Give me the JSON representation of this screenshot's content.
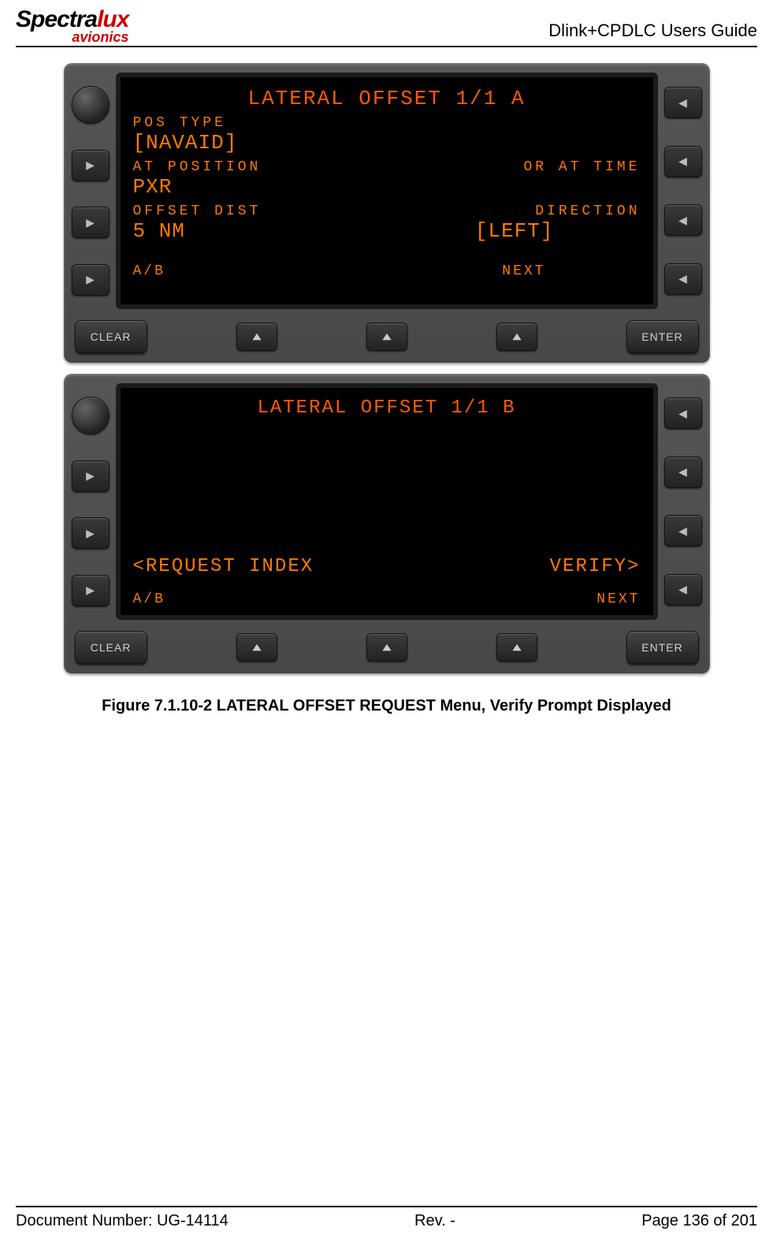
{
  "header": {
    "logo_top_1": "Spectra",
    "logo_top_2": "lux",
    "logo_bottom": "avionics",
    "doc_title": "Dlink+CPDLC Users Guide"
  },
  "device1": {
    "screen": {
      "title": "LATERAL OFFSET 1/1 A",
      "line1_left_label": "POS TYPE",
      "line1_left_value": "[NAVAID]",
      "line2_left_label": "AT POSITION",
      "line2_right_label": "OR AT TIME",
      "line2_left_value": "PXR",
      "line3_left_label": "OFFSET DIST",
      "line3_right_label": "DIRECTION",
      "line3_left_value": "5 NM",
      "line3_right_value": "[LEFT]",
      "footer_left": "A/B",
      "footer_right": "NEXT"
    },
    "buttons": {
      "clear": "CLEAR",
      "enter": "ENTER"
    }
  },
  "device2": {
    "screen": {
      "title": "LATERAL OFFSET 1/1 B",
      "line_left": "<REQUEST INDEX",
      "line_right": "VERIFY>",
      "footer_left": "A/B",
      "footer_right": "NEXT"
    },
    "buttons": {
      "clear": "CLEAR",
      "enter": "ENTER"
    }
  },
  "caption": "Figure 7.1.10-2 LATERAL OFFSET REQUEST Menu, Verify Prompt Displayed",
  "footer": {
    "left": "Document Number:  UG-14114",
    "center": "Rev. -",
    "right": "Page 136 of 201"
  }
}
